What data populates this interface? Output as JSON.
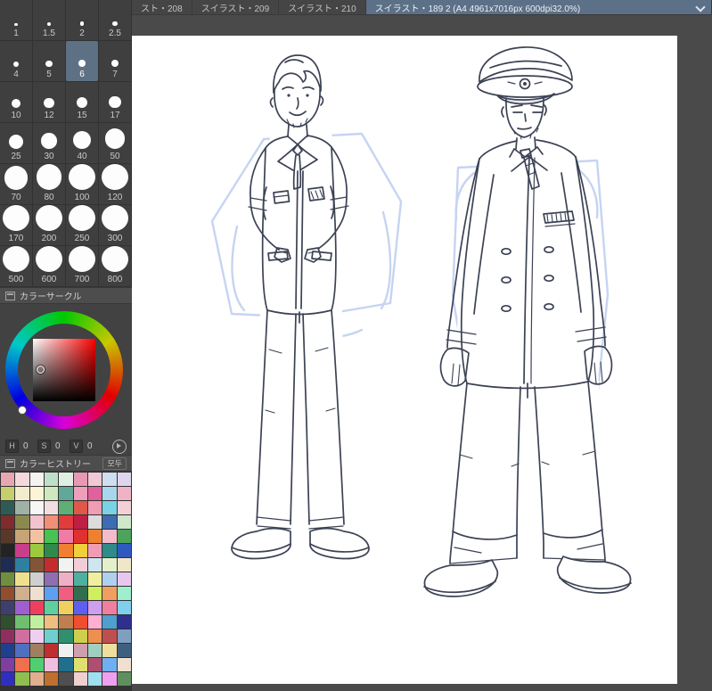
{
  "tabs": {
    "items": [
      {
        "label": "スト・208",
        "active": false
      },
      {
        "label": "スイラスト・209",
        "active": false
      },
      {
        "label": "スイラスト・210",
        "active": false
      },
      {
        "label": "スイラスト・189 2 (A4 4961x7016px 600dpi32.0%)",
        "active": true
      }
    ]
  },
  "brush_sizes": {
    "selected": "6",
    "items": [
      "1",
      "1.5",
      "2",
      "2.5",
      "4",
      "5",
      "6",
      "7",
      "10",
      "12",
      "15",
      "17",
      "25",
      "30",
      "40",
      "50",
      "70",
      "80",
      "100",
      "120",
      "170",
      "200",
      "250",
      "300",
      "500",
      "600",
      "700",
      "800"
    ]
  },
  "color_circle": {
    "title": "カラーサークル",
    "h_label": "H",
    "s_label": "S",
    "v_label": "V",
    "h": "0",
    "s": "0",
    "v": "0"
  },
  "color_history": {
    "title": "カラーヒストリー",
    "tab_label": "모두",
    "swatches": [
      "#e8a7b0",
      "#f3d9dc",
      "#f5f3ef",
      "#bfe0c8",
      "#dff0e2",
      "#e998b4",
      "#f0c9d4",
      "#cfdff0",
      "#ded6ee",
      "#c6cf6d",
      "#f1eccb",
      "#fdf3d7",
      "#cfe9bd",
      "#62a89a",
      "#ef9fb9",
      "#e0619b",
      "#a9d6ef",
      "#f0b3c5",
      "#2f5b55",
      "#9fb2a5",
      "#f6f6f4",
      "#f2dde1",
      "#5fae74",
      "#df5848",
      "#ef9db4",
      "#79d3e5",
      "#f3cfd6",
      "#7e2c2c",
      "#8a8a4e",
      "#f2c3cf",
      "#ef9077",
      "#e23b3b",
      "#c01f44",
      "#dcdcdc",
      "#3e6cb0",
      "#cfe7cb",
      "#59382c",
      "#c8a376",
      "#f2c3a2",
      "#47c353",
      "#f07ca6",
      "#e03030",
      "#f08030",
      "#f3bccb",
      "#4ba35c",
      "#232323",
      "#c73e8c",
      "#9cc93e",
      "#2f8a4c",
      "#f08030",
      "#efcf3a",
      "#f09cb6",
      "#2f8a8a",
      "#3059c0",
      "#1d2c55",
      "#2f7fa0",
      "#835537",
      "#c32d2d",
      "#f2f2f0",
      "#f0cdd7",
      "#cfe6f0",
      "#e4efcb",
      "#f0e7cb",
      "#6f8f3f",
      "#efe08f",
      "#cfcfcf",
      "#8f6fb0",
      "#efafc5",
      "#4fb0a0",
      "#efef9f",
      "#b0cfef",
      "#e8c7ef",
      "#8f4f2f",
      "#cfb08f",
      "#efdfcf",
      "#5f9fef",
      "#ef5f7f",
      "#2f6f4f",
      "#cfef5f",
      "#ef9f5f",
      "#9fefcf",
      "#3f3f6f",
      "#9f5fcf",
      "#ef3f5f",
      "#5fcf9f",
      "#efcf5f",
      "#5f5fef",
      "#cf9fef",
      "#ef7f9f",
      "#7fcfef",
      "#2f4f2f",
      "#6fbf6f",
      "#bfef9f",
      "#efbf7f",
      "#bf7f4f",
      "#ef4f2f",
      "#ffafcf",
      "#4f9fcf",
      "#2f2f8f",
      "#8f2f5f",
      "#cf6f9f",
      "#efcfef",
      "#6fcfcf",
      "#2f8f6f",
      "#cfcf4f",
      "#ef8f4f",
      "#bf4f4f",
      "#7f9fbf",
      "#1f3f8f",
      "#4f6fbf",
      "#9f7f5f",
      "#bf2f2f",
      "#efefef",
      "#cf9faf",
      "#9fcfbf",
      "#efdf9f",
      "#3f5f7f",
      "#7f3f9f",
      "#ef6f4f",
      "#4fcf6f",
      "#efbfdf",
      "#1f6f8f",
      "#dfdf6f",
      "#af4f6f",
      "#6fafef",
      "#efe0d0",
      "#2f2fbf",
      "#8fbf4f",
      "#dfaf8f",
      "#bf6f2f",
      "#4f4f4f",
      "#efcfcf",
      "#9fdfef",
      "#ef9fef",
      "#5f8f5f"
    ]
  },
  "colors": {
    "active_tab": "#5c7087",
    "selected_brush_bg": "#5e7184",
    "panel_bg": "#424242",
    "canvas_bg": "#ffffff",
    "sketch_ink": "#3c4254",
    "sketch_underdrawing": "#bdcdf0"
  }
}
